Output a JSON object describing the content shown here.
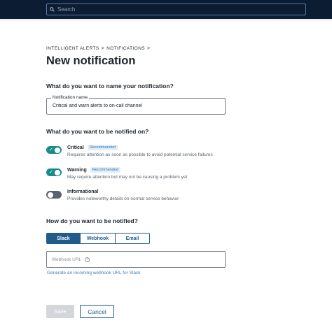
{
  "topbar": {
    "search_placeholder": "Search"
  },
  "breadcrumb": {
    "items": [
      "INTELLIGENT ALERTS",
      "NOTIFICATIONS"
    ],
    "separator": ">"
  },
  "page_title": "New notification",
  "name_section": {
    "question": "What do you want to name your notification?",
    "field_label": "Notification name",
    "field_value": "Critical and warn alerts to on-call channel"
  },
  "severity_section": {
    "question": "What do you want to be notified on?",
    "options": [
      {
        "title": "Critical",
        "badge": "Recommended",
        "description": "Requires attention as soon as possible to avoid potential service failures",
        "enabled": true
      },
      {
        "title": "Warning",
        "badge": "Recommended",
        "description": "May require attention but may not be causing a problem yet",
        "enabled": true
      },
      {
        "title": "Informational",
        "badge": "",
        "description": "Provides noteworthy details on normal service behavior",
        "enabled": false
      }
    ]
  },
  "channel_section": {
    "question": "How do you want to be notified?",
    "tabs": [
      "Slack",
      "Webhook",
      "Email"
    ],
    "active_tab": "Slack",
    "webhook_placeholder": "Webhook URL",
    "link_text": "Generate an incoming webhook URL for Slack"
  },
  "actions": {
    "save_label": "Save",
    "cancel_label": "Cancel"
  },
  "colors": {
    "topbar": "#0b1c33",
    "accent": "#1f5c8c",
    "toggle_on": "#1a8a8a",
    "toggle_off": "#596273",
    "link": "#3a7dbf"
  }
}
